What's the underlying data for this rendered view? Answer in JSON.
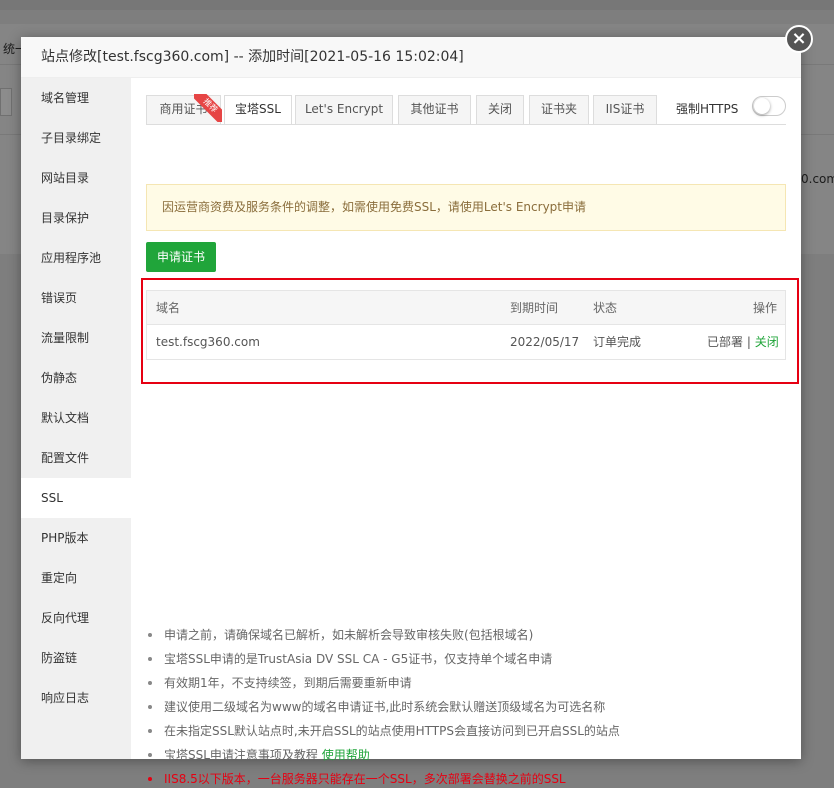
{
  "background": {
    "toolbar_fragment": "统一",
    "domain_fragment": "0.com"
  },
  "modal": {
    "title": "站点修改[test.fscg360.com] -- 添加时间[2021-05-16 15:02:04]",
    "close_glyph": "×"
  },
  "sidebar": {
    "items": [
      {
        "label": "域名管理"
      },
      {
        "label": "子目录绑定"
      },
      {
        "label": "网站目录"
      },
      {
        "label": "目录保护"
      },
      {
        "label": "应用程序池"
      },
      {
        "label": "错误页"
      },
      {
        "label": "流量限制"
      },
      {
        "label": "伪静态"
      },
      {
        "label": "默认文档"
      },
      {
        "label": "配置文件"
      },
      {
        "label": "SSL"
      },
      {
        "label": "PHP版本"
      },
      {
        "label": "重定向"
      },
      {
        "label": "反向代理"
      },
      {
        "label": "防盗链"
      },
      {
        "label": "响应日志"
      }
    ],
    "active": "SSL"
  },
  "tabs": {
    "items": [
      {
        "label": "商用证书",
        "badge": "推荐"
      },
      {
        "label": "宝塔SSL"
      },
      {
        "label": "Let's Encrypt"
      },
      {
        "label": "其他证书"
      },
      {
        "label": "关闭"
      },
      {
        "label": "证书夹"
      },
      {
        "label": "IIS证书"
      }
    ],
    "active": "宝塔SSL"
  },
  "force_https": {
    "label": "强制HTTPS",
    "enabled": false
  },
  "notice": {
    "text": "因运营商资费及服务条件的调整，如需使用免费SSL，请使用Let's Encrypt申请"
  },
  "apply_button": {
    "label": "申请证书"
  },
  "cert_table": {
    "headers": {
      "domain": "域名",
      "expiry": "到期时间",
      "status": "状态",
      "action": "操作"
    },
    "rows": [
      {
        "domain": "test.fscg360.com",
        "expiry": "2022/05/17",
        "status": "订单完成",
        "deployed": "已部署",
        "separator": "|",
        "close": "关闭"
      }
    ]
  },
  "tips": [
    {
      "text": "申请之前，请确保域名已解析，如未解析会导致审核失败(包括根域名)"
    },
    {
      "text": "宝塔SSL申请的是TrustAsia DV SSL CA - G5证书，仅支持单个域名申请"
    },
    {
      "text": "有效期1年，不支持续签，到期后需要重新申请"
    },
    {
      "text": "建议使用二级域名为www的域名申请证书,此时系统会默认赠送顶级域名为可选名称"
    },
    {
      "text": "在未指定SSL默认站点时,未开启SSL的站点使用HTTPS会直接访问到已开启SSL的站点"
    },
    {
      "text": "宝塔SSL申请注意事项及教程",
      "link": "使用帮助"
    },
    {
      "text": "IIS8.5以下版本，一台服务器只能存在一个SSL，多次部署会替换之前的SSL",
      "warning": true
    }
  ],
  "colors": {
    "accent_green": "#20a53a",
    "warning_red": "#e60012",
    "highlight_box": "#e60012"
  }
}
